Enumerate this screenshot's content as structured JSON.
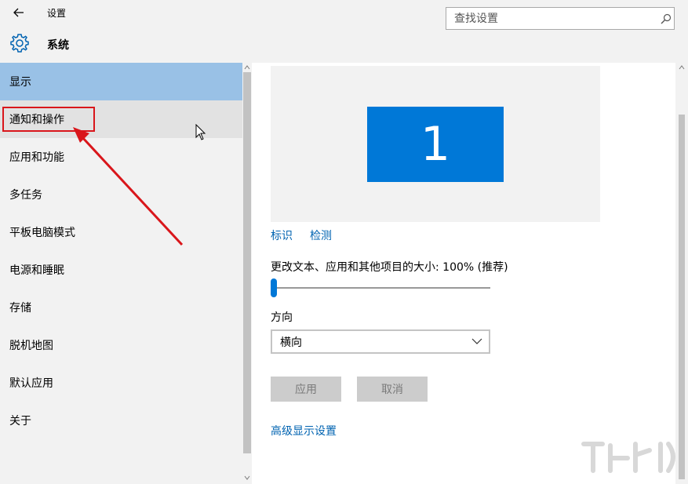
{
  "window": {
    "title": "设置",
    "controls": [
      "minimize",
      "maximize",
      "close"
    ]
  },
  "header": {
    "section_title": "系统",
    "search_placeholder": "查找设置",
    "section_icon": "gear-icon",
    "search_icon": "search-icon"
  },
  "sidebar": {
    "items": [
      {
        "label": "显示",
        "state": "selected"
      },
      {
        "label": "通知和操作",
        "state": "hover"
      },
      {
        "label": "应用和功能"
      },
      {
        "label": "多任务"
      },
      {
        "label": "平板电脑模式"
      },
      {
        "label": "电源和睡眠"
      },
      {
        "label": "存储"
      },
      {
        "label": "脱机地图"
      },
      {
        "label": "默认应用"
      },
      {
        "label": "关于"
      }
    ]
  },
  "main": {
    "monitor_number": "1",
    "identify_link": "标识",
    "detect_link": "检测",
    "scale_label": "更改文本、应用和其他项目的大小: 100% (推荐)",
    "scale_value_fraction": 0.0,
    "orientation_label": "方向",
    "orientation_value": "横向",
    "apply_button": "应用",
    "cancel_button": "取消",
    "advanced_link": "高级显示设置"
  },
  "colors": {
    "accent": "#0078d7",
    "selected_nav": "#99c1e6",
    "link": "#0063b1",
    "annotation": "#d9161b"
  }
}
